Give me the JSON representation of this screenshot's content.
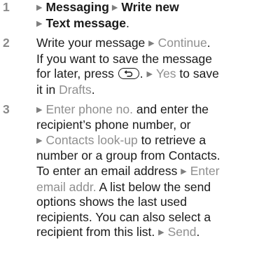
{
  "steps": [
    {
      "number": "1",
      "line1": {
        "item1": "Messaging",
        "item2": "Write new"
      },
      "line2": {
        "item": "Text message",
        "end": "."
      }
    },
    {
      "number": "2",
      "line1": {
        "text": "Write your message",
        "action": "Continue",
        "end": "."
      },
      "line2": "If you want to save the message",
      "line3": {
        "before": "for later, press",
        "mid": ".",
        "action": "Yes",
        "after": "to save"
      },
      "line4": {
        "before": "it in",
        "folder": "Drafts",
        "end": "."
      }
    },
    {
      "number": "3",
      "line1": {
        "action": "Enter phone no.",
        "after": "and enter the"
      },
      "line2": "recipient’s phone number, or",
      "line3": {
        "action": "Contacts look-up",
        "after": "to retrieve a"
      },
      "line4": "number or a group from Contacts.",
      "line5": {
        "before": "To enter an email address",
        "action": "Enter"
      },
      "line6": {
        "action": "email addr.",
        "after": "A list below the send"
      },
      "line7": "options shows the last used",
      "line8": "recipients. You can also select a",
      "line9": {
        "before": "recipient from this list.",
        "action": "Send",
        "end": "."
      }
    }
  ],
  "colors": {
    "text": "#1a1a1a",
    "highlight": "#8f8f8f",
    "step_number": "#8a8a8a"
  },
  "icons": {
    "arrow": "right-triangle-icon",
    "back_key": "back-key-icon"
  }
}
